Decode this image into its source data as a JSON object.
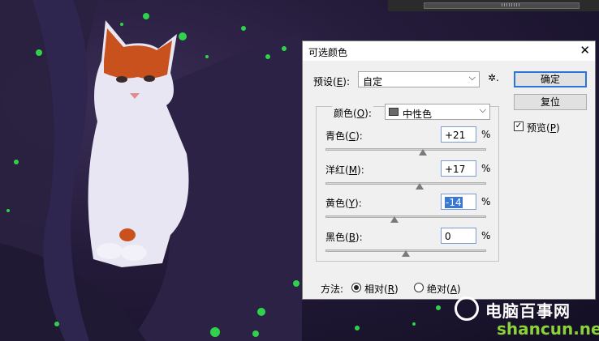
{
  "dialog": {
    "title": "可选颜色",
    "close_glyph": "✕",
    "preset_label": "预设(",
    "preset_key": "E",
    "preset_label_end": "):",
    "preset_value": "自定",
    "gear_glyph": "✲.",
    "colors_label": "颜色(",
    "colors_key": "O",
    "colors_label_end": "):",
    "colors_value": "中性色",
    "sliders": [
      {
        "label": "青色(",
        "key": "C",
        "end": "):",
        "value": "+21",
        "level": 0.605,
        "selected": false
      },
      {
        "label": "洋红(",
        "key": "M",
        "end": "):",
        "value": "+17",
        "level": 0.585,
        "selected": false
      },
      {
        "label": "黄色(",
        "key": "Y",
        "end": "):",
        "value": "-14",
        "level": 0.43,
        "selected": true
      },
      {
        "label": "黑色(",
        "key": "B",
        "end": "):",
        "value": "0",
        "level": 0.5,
        "selected": false
      }
    ],
    "percent": "%",
    "ok_label": "确定",
    "reset_label": "复位",
    "preview_label": "预览(",
    "preview_key": "P",
    "preview_label_end": ")",
    "preview_checked": true,
    "method_label": "方法:",
    "method_relative": "相对(",
    "method_relative_key": "R",
    "method_absolute": "绝对(",
    "method_absolute_key": "A",
    "method_end": ")",
    "method_selected": "relative"
  },
  "watermark": {
    "line1": "电脑百事网",
    "line2": "shancun.net"
  },
  "colors": {
    "dialog_bg": "#f0f0f0",
    "accent": "#2c74d8",
    "selection": "#3a78d6",
    "cat_orange": "#c8511e",
    "glitter_green": "#2fd24a"
  }
}
